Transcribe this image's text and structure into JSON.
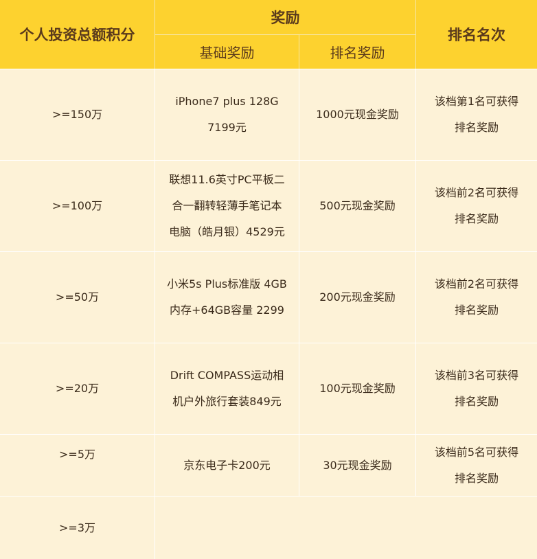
{
  "header": {
    "col_total": "个人投资总额积分",
    "col_reward": "奖励",
    "col_basic": "基础奖励",
    "col_rank_reward": "排名奖励",
    "col_rank": "排名名次"
  },
  "rows": [
    {
      "tier": ">=150万",
      "basic": [
        "iPhone7 plus 128G",
        "7199元"
      ],
      "rank_reward": "1000元现金奖励",
      "rank": [
        "该档第1名可获得",
        "排名奖励"
      ]
    },
    {
      "tier": ">=100万",
      "basic": [
        "联想11.6英寸PC平板二",
        "合一翻转轻薄手笔记本",
        "电脑（皓月银）4529元"
      ],
      "rank_reward": "500元现金奖励",
      "rank": [
        "该档前2名可获得",
        "排名奖励"
      ]
    },
    {
      "tier": ">=50万",
      "basic": [
        "小米5s Plus标准版 4GB",
        "内存+64GB容量 2299"
      ],
      "rank_reward": "200元现金奖励",
      "rank": [
        "该档前2名可获得",
        "排名奖励"
      ]
    },
    {
      "tier": ">=20万",
      "basic": [
        "Drift COMPASS运动相",
        "机户外旅行套装849元"
      ],
      "rank_reward": "100元现金奖励",
      "rank": [
        "该档前3名可获得",
        "排名奖励"
      ]
    },
    {
      "tier": ">=5万",
      "basic": [
        "京东电子卡200元"
      ],
      "rank_reward": "30元现金奖励",
      "rank": [
        "该档前5名可获得",
        "排名奖励"
      ]
    },
    {
      "tier": ">=3万",
      "basic": [],
      "rank_reward": "",
      "rank": []
    }
  ]
}
